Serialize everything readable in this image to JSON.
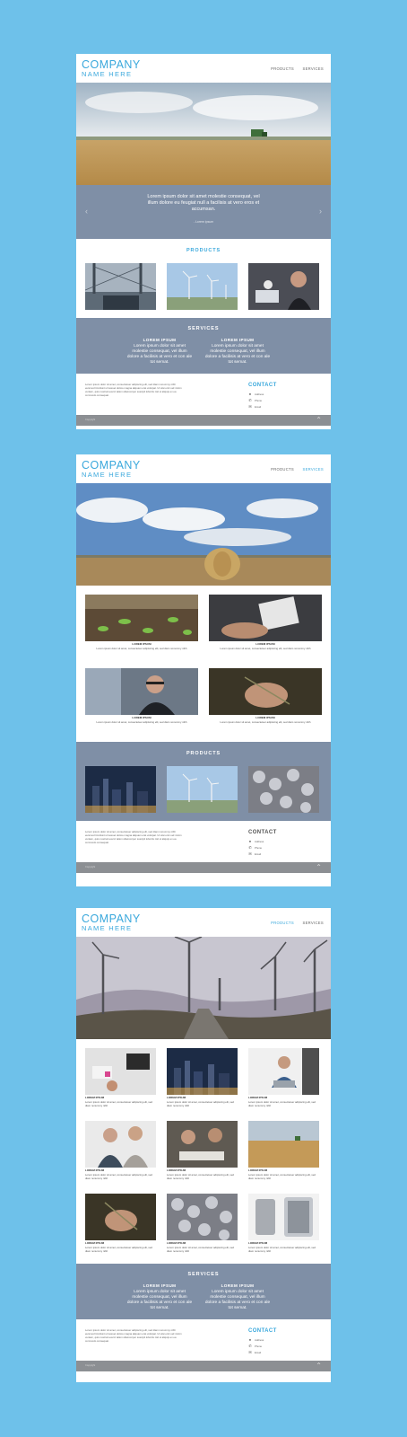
{
  "brand": {
    "line1": "COMPANY",
    "line2": "NAME HERE"
  },
  "nav": {
    "products": "PRODUCTS",
    "services": "SERVICES"
  },
  "page1": {
    "quote": "Lorem ipsum dolor sit amet molestie consequat, vel illum dolore eu feugiat null a facilisis at vero eros et accumsan.",
    "quote_author": "- Lorem ipsum",
    "products_title": "PRODUCTS",
    "services_title": "SERVICES",
    "services": [
      {
        "title": "LOREM IPSUM",
        "text": "Lorem ipsum dolor sit amet molestie consequat, vel illum dolore a facilisis at vero et con ale tot semat."
      },
      {
        "title": "LOREM IPSUM",
        "text": "Lorem ipsum dolor sit amet molestie consequat, vel illum dolore a facilisis at vero et con ale tot semat."
      }
    ]
  },
  "page2": {
    "cards": [
      {
        "title": "LOREM IPSUM",
        "text": "Lorem ipsum dolor sit amet, consectetuer adipiscing elit, sed diam nonummy nibh"
      },
      {
        "title": "LOREM IPSUM",
        "text": "Lorem ipsum dolor sit amet, consectetuer adipiscing elit, sed diam nonummy nibh"
      },
      {
        "title": "LOREM IPSUM",
        "text": "Lorem ipsum dolor sit amet, consectetuer adipiscing elit, sed diam nonummy nibh"
      },
      {
        "title": "LOREM IPSUM",
        "text": "Lorem ipsum dolor sit amet, consectetuer adipiscing elit, sed diam nonummy nibh"
      }
    ],
    "products_title": "PRODUCTS"
  },
  "page3": {
    "cards": [
      {
        "title": "LOREM IPSUM",
        "text": "Lorem ipsum dolor sit amet, consectetuer adipiscing elit, sed diam nonummy nibh"
      },
      {
        "title": "LOREM IPSUM",
        "text": "Lorem ipsum dolor sit amet, consectetuer adipiscing elit, sed diam nonummy nibh"
      },
      {
        "title": "LOREM IPSUM",
        "text": "Lorem ipsum dolor sit amet, consectetuer adipiscing elit, sed diam nonummy nibh"
      },
      {
        "title": "LOREM IPSUM",
        "text": "Lorem ipsum dolor sit amet, consectetuer adipiscing elit, sed diam nonummy nibh"
      },
      {
        "title": "LOREM IPSUM",
        "text": "Lorem ipsum dolor sit amet, consectetuer adipiscing elit, sed diam nonummy nibh"
      },
      {
        "title": "LOREM IPSUM",
        "text": "Lorem ipsum dolor sit amet, consectetuer adipiscing elit, sed diam nonummy nibh"
      },
      {
        "title": "LOREM IPSUM",
        "text": "Lorem ipsum dolor sit amet, consectetuer adipiscing elit, sed diam nonummy nibh"
      },
      {
        "title": "LOREM IPSUM",
        "text": "Lorem ipsum dolor sit amet, consectetuer adipiscing elit, sed diam nonummy nibh"
      },
      {
        "title": "LOREM IPSUM",
        "text": "Lorem ipsum dolor sit amet, consectetuer adipiscing elit, sed diam nonummy nibh"
      }
    ],
    "services_title": "SERVICES",
    "services": [
      {
        "title": "LOREM IPSUM",
        "text": "Lorem ipsum dolor sit amet molestie consequat, vel illum dolore a facilisis at vero et con ale tot semat."
      },
      {
        "title": "LOREM IPSUM",
        "text": "Lorem ipsum dolor sit amet molestie consequat, vel illum dolore a facilisis at vero et con ale tot semat."
      }
    ]
  },
  "footer": {
    "text": "Lorem ipsum dolor sit amet, consectetuer adipiscing elit, sed diam nonummy nibh euismod tincidunt ut laoreet dolore magna aliquam erat volutpat. Ut wisi enim ad minim veniam, quis nostrud exerci tation ullamcorper suscipit lobortis nisl ut aliquip ex ea commodo consequat.",
    "contact_title": "CONTACT",
    "address": "Address",
    "phone": "Phone",
    "email": "Email",
    "copyright": "Copyright",
    "up_icon": "chevron-up-icon"
  },
  "colors": {
    "background": "#6ec1ea",
    "accent": "#3aa8dc",
    "slate": "#7f8fa6",
    "bottom_bar": "#8c8f93"
  }
}
